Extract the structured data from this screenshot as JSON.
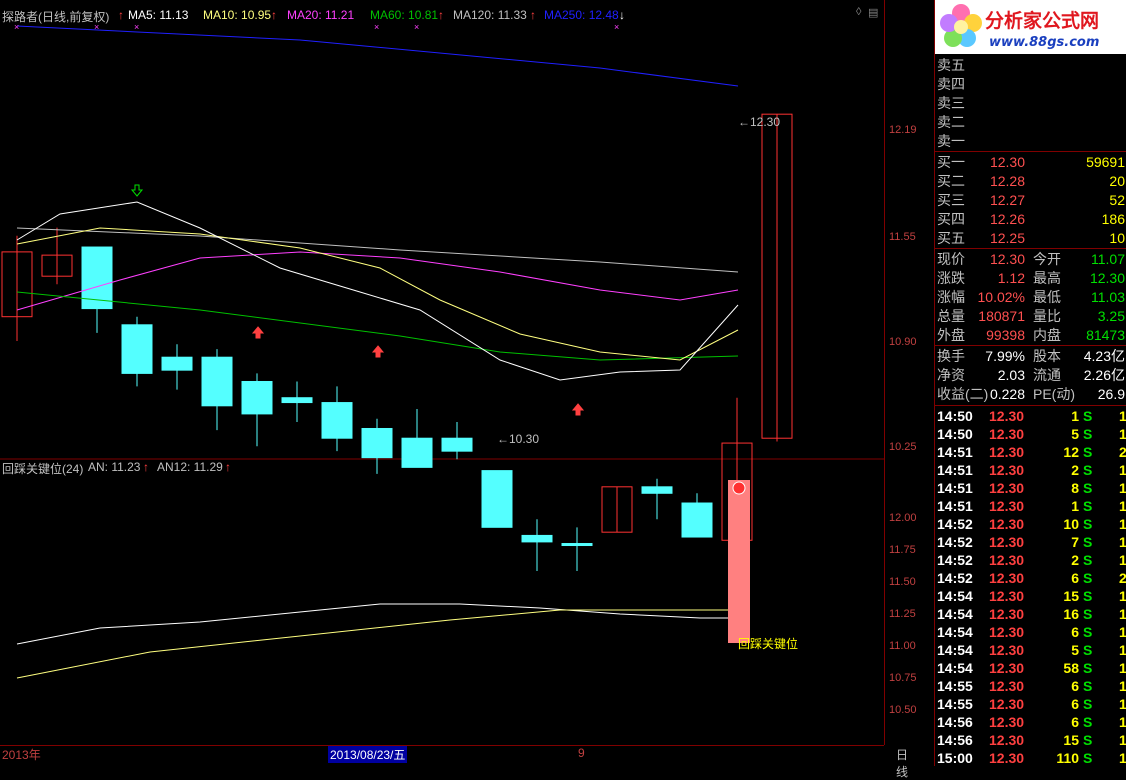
{
  "legend": {
    "title": "探路者(日线,前复权)",
    "ma5": "MA5: 11.13",
    "ma10": "MA10: 10.95",
    "ma20": "MA20: 11.21",
    "ma60": "MA60: 10.81",
    "ma120": "MA120: 11.33",
    "ma250": "MA250: 12.48"
  },
  "indicator_legend": {
    "title": "回踩关键位(24)",
    "an": "AN: 11.23",
    "an12": "AN12: 11.29",
    "bar_label": "回踩关键位"
  },
  "price_axis": [
    "12.19",
    "11.55",
    "10.90",
    "10.25"
  ],
  "indicator_axis": [
    "12.00",
    "11.75",
    "11.50",
    "11.25",
    "11.00",
    "10.75",
    "10.50"
  ],
  "annotations": {
    "high": "12.30",
    "low": "10.30"
  },
  "date_bar": {
    "year": "2013年",
    "cursor_date": "2013/08/23/五",
    "month": "9",
    "period": "日线"
  },
  "logo": {
    "text": "分析家公式网",
    "url": "www.88gs.com"
  },
  "order_book": {
    "sell": [
      "卖五",
      "卖四",
      "卖三",
      "卖二",
      "卖一"
    ],
    "buy": [
      {
        "label": "买一",
        "price": "12.30",
        "vol": "59691"
      },
      {
        "label": "买二",
        "price": "12.28",
        "vol": "20"
      },
      {
        "label": "买三",
        "price": "12.27",
        "vol": "52"
      },
      {
        "label": "买四",
        "price": "12.26",
        "vol": "186"
      },
      {
        "label": "买五",
        "price": "12.25",
        "vol": "10"
      }
    ]
  },
  "quote": [
    {
      "l1": "现价",
      "v1": "12.30",
      "l2": "今开",
      "v2": "11.07"
    },
    {
      "l1": "涨跌",
      "v1": "1.12",
      "l2": "最高",
      "v2": "12.30"
    },
    {
      "l1": "涨幅",
      "v1": "10.02%",
      "l2": "最低",
      "v2": "11.03"
    },
    {
      "l1": "总量",
      "v1": "180871",
      "l2": "量比",
      "v2": "3.25"
    },
    {
      "l1": "外盘",
      "v1": "99398",
      "l2": "内盘",
      "v2": "81473"
    }
  ],
  "fundamentals": [
    {
      "l1": "换手",
      "v1": "7.99%",
      "l2": "股本",
      "v2": "4.23亿"
    },
    {
      "l1": "净资",
      "v1": "2.03",
      "l2": "流通",
      "v2": "2.26亿"
    },
    {
      "l1": "收益(二)",
      "v1": "0.228",
      "l2": "PE(动)",
      "v2": "26.9"
    }
  ],
  "ticks": [
    {
      "t": "14:50",
      "p": "12.30",
      "q": "1",
      "s": "S",
      "n": "1"
    },
    {
      "t": "14:50",
      "p": "12.30",
      "q": "5",
      "s": "S",
      "n": "1"
    },
    {
      "t": "14:51",
      "p": "12.30",
      "q": "12",
      "s": "S",
      "n": "2"
    },
    {
      "t": "14:51",
      "p": "12.30",
      "q": "2",
      "s": "S",
      "n": "1"
    },
    {
      "t": "14:51",
      "p": "12.30",
      "q": "8",
      "s": "S",
      "n": "1"
    },
    {
      "t": "14:51",
      "p": "12.30",
      "q": "1",
      "s": "S",
      "n": "1"
    },
    {
      "t": "14:52",
      "p": "12.30",
      "q": "10",
      "s": "S",
      "n": "1"
    },
    {
      "t": "14:52",
      "p": "12.30",
      "q": "7",
      "s": "S",
      "n": "1"
    },
    {
      "t": "14:52",
      "p": "12.30",
      "q": "2",
      "s": "S",
      "n": "1"
    },
    {
      "t": "14:52",
      "p": "12.30",
      "q": "6",
      "s": "S",
      "n": "2"
    },
    {
      "t": "14:54",
      "p": "12.30",
      "q": "15",
      "s": "S",
      "n": "1"
    },
    {
      "t": "14:54",
      "p": "12.30",
      "q": "16",
      "s": "S",
      "n": "1"
    },
    {
      "t": "14:54",
      "p": "12.30",
      "q": "6",
      "s": "S",
      "n": "1"
    },
    {
      "t": "14:54",
      "p": "12.30",
      "q": "5",
      "s": "S",
      "n": "1"
    },
    {
      "t": "14:54",
      "p": "12.30",
      "q": "58",
      "s": "S",
      "n": "1"
    },
    {
      "t": "14:55",
      "p": "12.30",
      "q": "6",
      "s": "S",
      "n": "1"
    },
    {
      "t": "14:55",
      "p": "12.30",
      "q": "6",
      "s": "S",
      "n": "1"
    },
    {
      "t": "14:56",
      "p": "12.30",
      "q": "6",
      "s": "S",
      "n": "1"
    },
    {
      "t": "14:56",
      "p": "12.30",
      "q": "15",
      "s": "S",
      "n": "1"
    },
    {
      "t": "15:00",
      "p": "12.30",
      "q": "110",
      "s": "S",
      "n": "1"
    }
  ],
  "colors": {
    "up": "#ff3232",
    "down": "#54ffff",
    "ma5": "#ffffff",
    "ma10": "#ffff80",
    "ma20": "#ff40ff",
    "ma60": "#00c000",
    "ma120": "#c0c0c0",
    "ma250": "#2020ff"
  }
}
